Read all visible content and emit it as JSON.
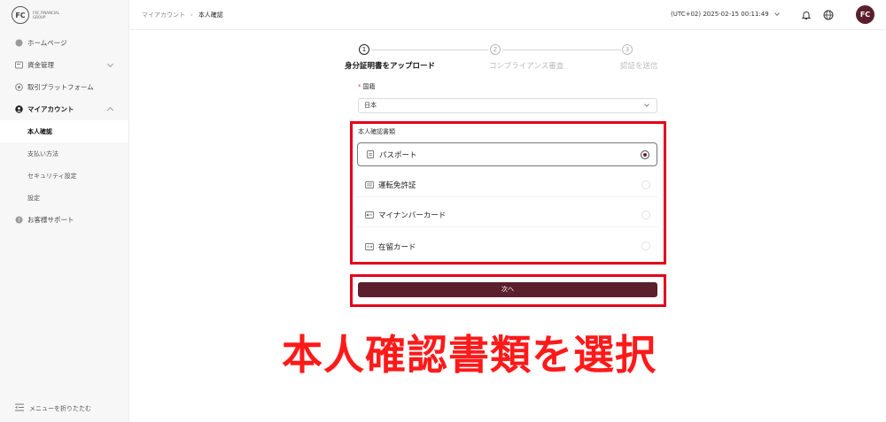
{
  "logo": {
    "mark": "FC",
    "text": "FXC FINANCIAL GROUP"
  },
  "sidebar": {
    "items": [
      {
        "label": "ホームページ",
        "icon": "home-icon"
      },
      {
        "label": "資金管理",
        "icon": "wallet-icon"
      },
      {
        "label": "取引プラットフォーム",
        "icon": "platform-icon"
      },
      {
        "label": "マイアカウント",
        "icon": "user-icon"
      },
      {
        "label": "本人確認"
      },
      {
        "label": "支払い方法"
      },
      {
        "label": "セキュリティ設定"
      },
      {
        "label": "設定"
      },
      {
        "label": "お客様サポート",
        "icon": "support-icon"
      }
    ],
    "footer": "メニューを折りたたむ"
  },
  "header": {
    "breadcrumb": {
      "parent": "マイアカウント",
      "current": "本人確認"
    },
    "timezone": "(UTC+02)  2025-02-15 00:11:49",
    "avatar": "FC"
  },
  "stepper": {
    "steps": [
      {
        "num": "1",
        "label": "身分証明書をアップロード"
      },
      {
        "num": "2",
        "label": "コンプライアンス審査"
      },
      {
        "num": "3",
        "label": "認証を送信"
      }
    ]
  },
  "form": {
    "country_label": "国籍",
    "country_value": "日本",
    "doc_type_label": "本人確認書類",
    "options": [
      {
        "label": "パスポート",
        "icon": "passport-icon",
        "selected": true
      },
      {
        "label": "運転免許証",
        "icon": "license-icon",
        "selected": false
      },
      {
        "label": "マイナンバーカード",
        "icon": "id-card-icon",
        "selected": false
      },
      {
        "label": "在留カード",
        "icon": "residence-card-icon",
        "selected": false
      }
    ],
    "next_label": "次へ"
  },
  "annotation": "本人確認書類を選択",
  "colors": {
    "brand": "#5c1f2e",
    "highlight": "#e3001b",
    "annotation": "#ff1a1a"
  }
}
